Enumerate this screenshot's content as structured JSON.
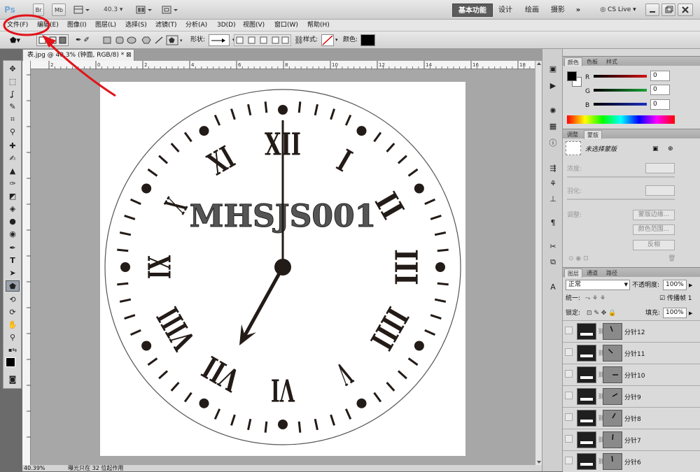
{
  "app": {
    "logo": "Ps",
    "br_label": "Br",
    "mb_label": "Mb",
    "zoom_field": "40.3",
    "workspaces": [
      "基本功能",
      "设计",
      "绘画",
      "摄影"
    ],
    "more": "»",
    "cslive": "CS Live"
  },
  "menu": [
    "文件(F)",
    "编辑(E)",
    "图像(I)",
    "图层(L)",
    "选择(S)",
    "滤镜(T)",
    "分析(A)",
    "3D(D)",
    "视图(V)",
    "窗口(W)",
    "帮助(H)"
  ],
  "options": {
    "shape_label": "形状:",
    "style_label": "样式:",
    "color_label": "颜色:",
    "color": "#000000"
  },
  "document": {
    "tab_title": "表.jpg @ 40.3% (钟面, RGB/8) *",
    "ruler_h": [
      "2",
      "0",
      "2",
      "4",
      "6",
      "8",
      "10",
      "12",
      "14",
      "16",
      "18"
    ],
    "status_zoom": "40.39%",
    "status_text": "曝光只在 32 位起作用"
  },
  "clock": {
    "numerals": [
      "XII",
      "I",
      "II",
      "III",
      "IIII",
      "V",
      "VI",
      "VII",
      "VIII",
      "IX",
      "X",
      "XI"
    ],
    "label": "MHSJS001",
    "hour_angle_deg": 209,
    "minute_angle_deg": 0,
    "face_color": "#ffffff",
    "ink_color": "#231b17"
  },
  "annotation": {
    "color": "#e0141b"
  },
  "color_panel": {
    "tabs": [
      "颜色",
      "色板",
      "样式"
    ],
    "channels": [
      {
        "name": "R",
        "value": "0",
        "color": "#d31313"
      },
      {
        "name": "G",
        "value": "0",
        "color": "#1aa336"
      },
      {
        "name": "B",
        "value": "0",
        "color": "#1a2fc1"
      }
    ]
  },
  "mask_panel": {
    "tabs": [
      "调整",
      "蒙版"
    ],
    "title": "未选择蒙版",
    "density": "浓度:",
    "feather": "羽化:",
    "refine": "调整:",
    "buttons": [
      "蒙版边缘...",
      "颜色范围...",
      "反相"
    ]
  },
  "layers_panel": {
    "tabs": [
      "图层",
      "通道",
      "路径"
    ],
    "blend_mode": "正常",
    "opacity_label": "不透明度:",
    "opacity": "100%",
    "unify_label": "统一:",
    "propagate_label": "传播帧 1",
    "lock_label": "锁定:",
    "fill_label": "填充:",
    "fill": "100%",
    "layers": [
      {
        "name": "分针12",
        "angle": -20
      },
      {
        "name": "分针11",
        "angle": -45
      },
      {
        "name": "分针10",
        "angle": 90
      },
      {
        "name": "分针9",
        "angle": 60
      },
      {
        "name": "分针8",
        "angle": 30
      },
      {
        "name": "分针7",
        "angle": 5
      },
      {
        "name": "分针6",
        "angle": -5
      }
    ]
  }
}
